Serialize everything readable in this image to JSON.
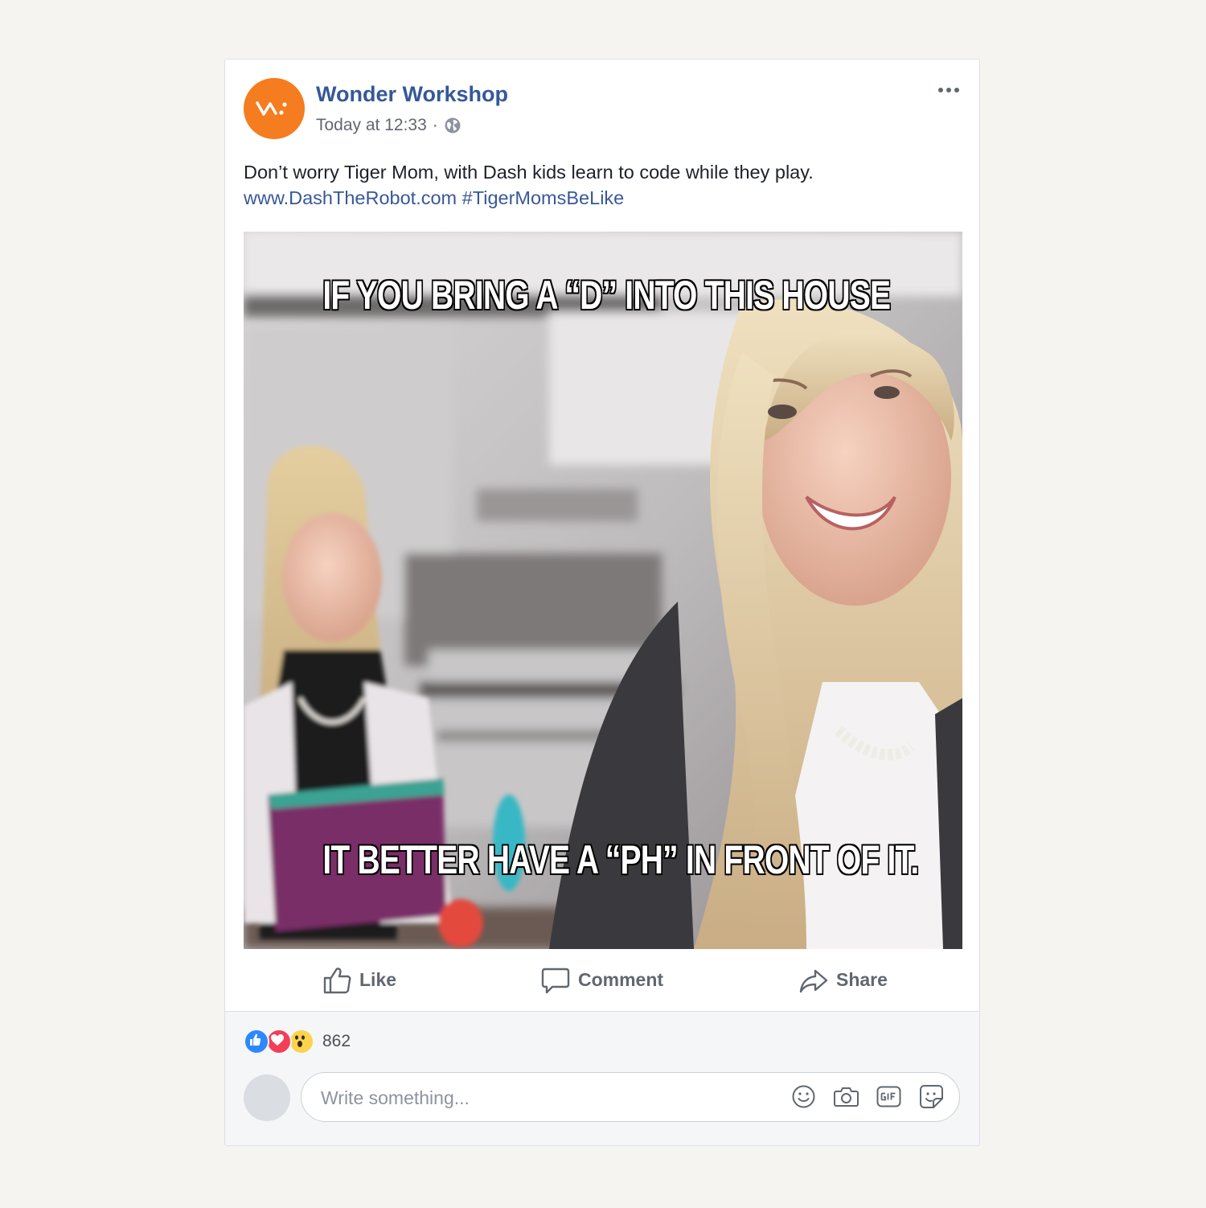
{
  "post": {
    "page_name": "Wonder Workshop",
    "timestamp": "Today at 12:33",
    "separator": "·",
    "privacy_icon": "globe-icon",
    "text": "Don’t worry Tiger Mom, with Dash kids learn to code while they play.",
    "link": "www.DashTheRobot.com",
    "hashtag": "#TigerMomsBeLike",
    "brand_color": "#f57c1f",
    "link_color": "#385898"
  },
  "meme": {
    "top_caption": "IF YOU BRING A “D” INTO THIS HOUSE",
    "bottom_caption": "IT BETTER HAVE A “PH” IN FRONT OF IT."
  },
  "actions": {
    "like_label": "Like",
    "comment_label": "Comment",
    "share_label": "Share"
  },
  "reactions": {
    "count": "862",
    "types": [
      "like-icon",
      "love-icon",
      "wow-icon"
    ]
  },
  "comment_box": {
    "placeholder": "Write something...",
    "icons": [
      "emoji-icon",
      "camera-icon",
      "gif-icon",
      "sticker-icon"
    ]
  }
}
